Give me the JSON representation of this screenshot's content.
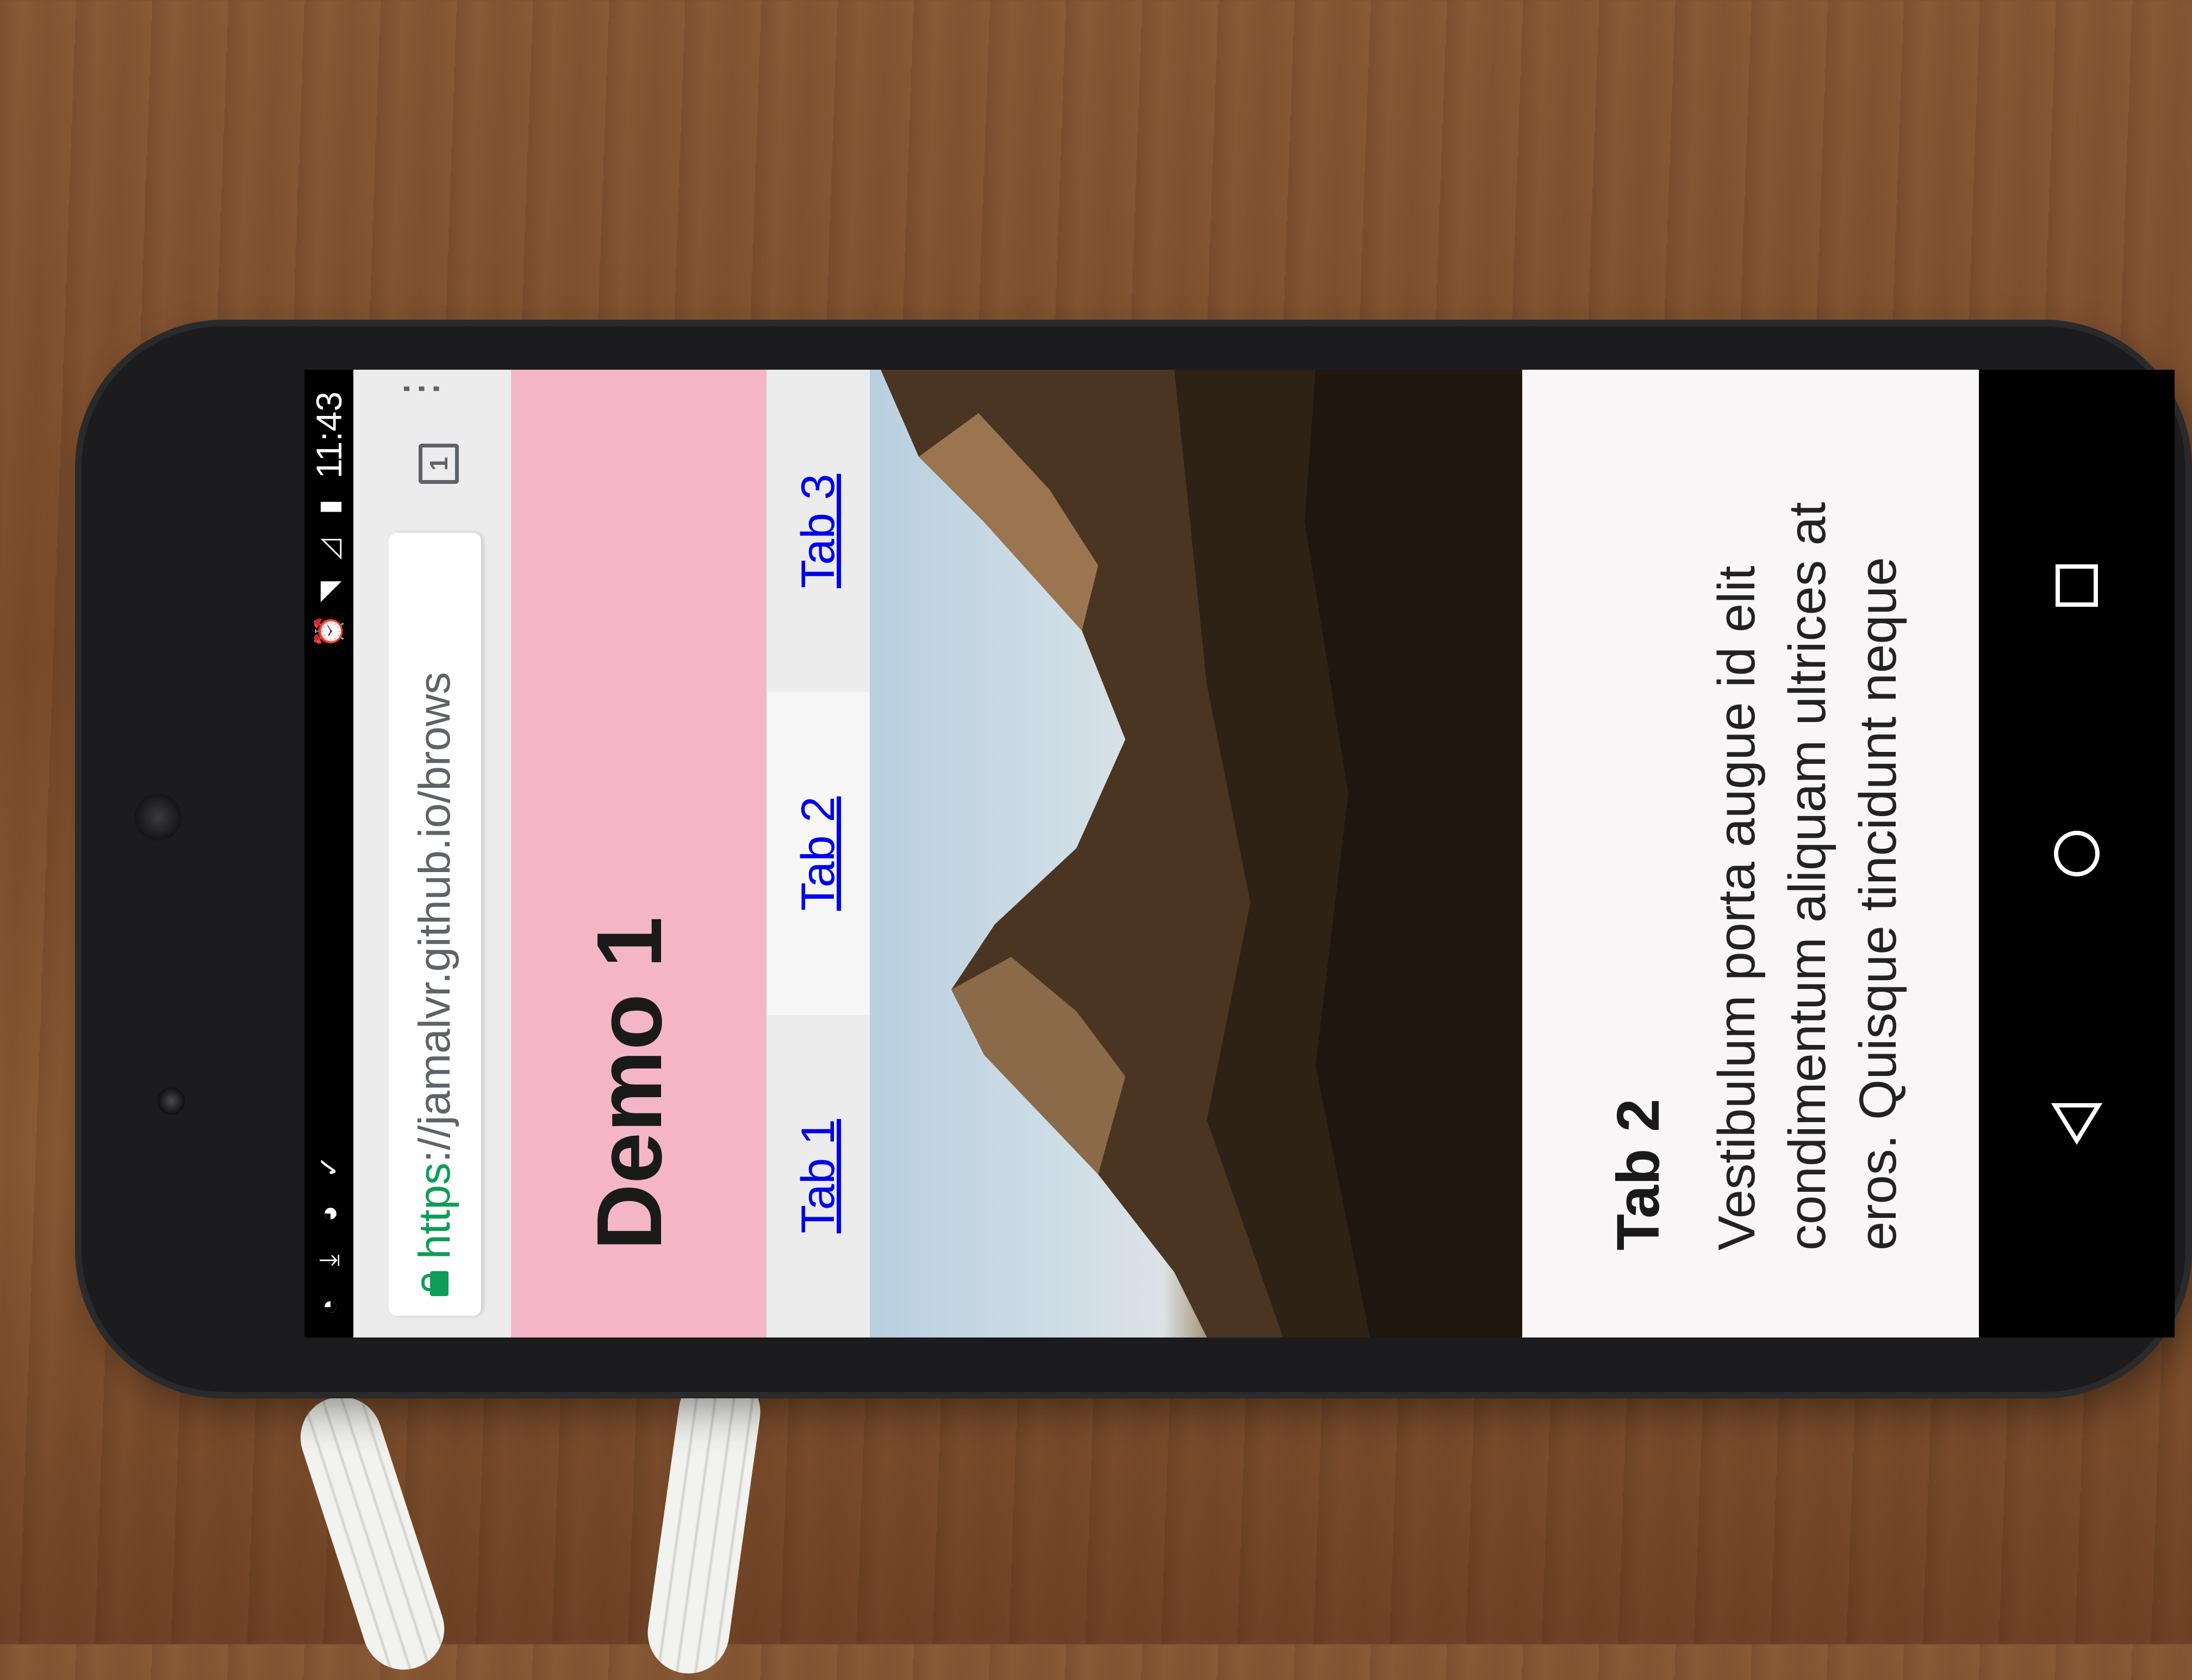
{
  "status_bar": {
    "time": "11:43",
    "left_icons": [
      "wifi-question-icon",
      "download-icon",
      "android-icon",
      "check-notification-icon"
    ],
    "right_icons": [
      "alarm-icon",
      "wifi-icon",
      "no-signal-icon",
      "battery-charging-icon"
    ]
  },
  "browser": {
    "url_scheme": "https",
    "url_rest": "://jamalvr.github.io/brows",
    "tab_count": "1"
  },
  "page": {
    "title": "Demo 1",
    "tabs": [
      {
        "label": "Tab 1"
      },
      {
        "label": "Tab 2"
      },
      {
        "label": "Tab 3"
      }
    ],
    "content": {
      "heading": "Tab 2",
      "body": "Vestibulum porta augue id elit condimentum aliquam ultrices at eros. Quisque tincidunt neque"
    }
  },
  "colors": {
    "header_bg": "#f4b6c6",
    "link": "#0000ee",
    "secure_green": "#0f9d58"
  },
  "nav_bar": {
    "buttons": [
      "back-icon",
      "home-icon",
      "recents-icon"
    ]
  }
}
